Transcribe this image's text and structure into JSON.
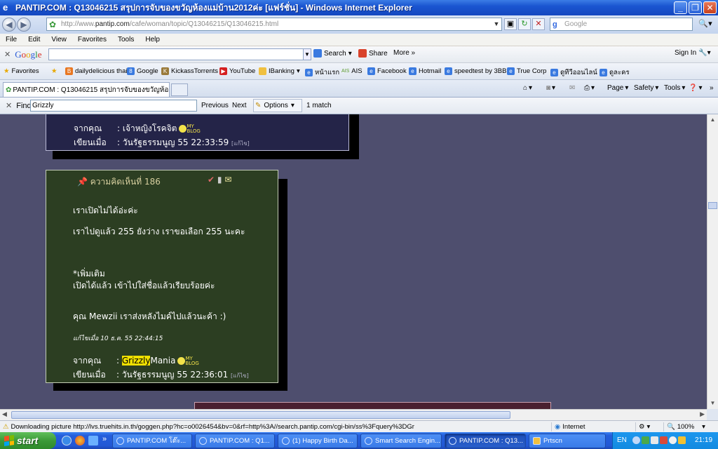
{
  "window": {
    "title": "PANTIP.COM : Q13046215 สรุปการจับของขวัญห้องแม่บ้าน2012ค่ะ [แฟร์ชั่น] - Windows Internet Explorer",
    "controls": [
      "_",
      "❐",
      "✕"
    ]
  },
  "address_bar": {
    "url_prefix": "http://www.",
    "url_domain": "pantip.com",
    "url_path": "/cafe/woman/topic/Q13046215/Q13046215.html",
    "search_placeholder": "Google"
  },
  "menu": [
    "File",
    "Edit",
    "View",
    "Favorites",
    "Tools",
    "Help"
  ],
  "google_toolbar": {
    "logo": "Google",
    "search_label": "Search",
    "share_label": "Share",
    "more_label": "More »",
    "signin_label": "Sign In"
  },
  "favorites_bar": {
    "favorites_label": "Favorites",
    "items": [
      "dailydelicious thai",
      "Google",
      "KickassTorrents",
      "YouTube",
      "IBanking",
      "หน้าแรก",
      "AIS",
      "Facebook",
      "Hotmail",
      "speedtest by 3BB",
      "True Corp",
      "ดูทีวีออนไลน์",
      "ดูละคร"
    ]
  },
  "tabs": {
    "active_tab": "PANTIP.COM : Q13046215 สรุปการจับของขวัญห้องแม่บ้าน...",
    "commands": [
      "Page",
      "Safety",
      "Tools"
    ]
  },
  "find_bar": {
    "label": "Find:",
    "query": "Grizzly",
    "previous": "Previous",
    "next": "Next",
    "options": "Options",
    "result": "1 match"
  },
  "comments": {
    "prev": {
      "from_label": "จากคุณ",
      "from_value": ": เจ้าหญิงโรคจิต",
      "date_label": "เขียนเมื่อ",
      "date_value": ": วันรัฐธรรมนูญ 55 22:33:59",
      "edit_link": "[แก้ไข]"
    },
    "current": {
      "header": "ความคิดเห็นที่ 186",
      "line1": "เราเปิดไม่ได้อ่ะค่ะ",
      "line2": "เราไปดูแล้ว 255 ยังว่าง เราขอเลือก 255 นะคะ",
      "line3": "*เพิ่มเติม",
      "line4": "เปิดได้แล้ว เข้าไปใส่ชื่อแล้วเรียบร้อยค่ะ",
      "line5": "คุณ Mewzii เราส่งหลังไมค์ไปแล้วนะค้า :)",
      "edited": "แก้ไขเมื่อ 10 ธ.ค. 55 22:44:15",
      "from_label": "จากคุณ",
      "from_prefix": ": ",
      "from_highlight": "Grizzly",
      "from_rest": "Mania",
      "date_label": "เขียนเมื่อ",
      "date_value": ": วันรัฐธรรมนูญ 55 22:36:01",
      "edit_link": "[แก้ไข]",
      "blog_badge": "MY BLOG"
    }
  },
  "status_bar": {
    "message": "Downloading picture http://lvs.truehits.in.th/goggen.php?hc=o0026454&bv=0&rf=http%3A//search.pantip.com/cgi-bin/ss%3Fquery%3DGr",
    "zone": "Internet",
    "zoom": "100%"
  },
  "taskbar": {
    "start_label": "start",
    "tasks": [
      "PANTIP.COM โต๊ะ...",
      "PANTIP.COM : Q1...",
      "(1) Happy Birth Da...",
      "Smart Search Engin...",
      "PANTIP.COM : Q13...",
      "Prtscn"
    ],
    "language": "EN",
    "clock": "21:19"
  }
}
